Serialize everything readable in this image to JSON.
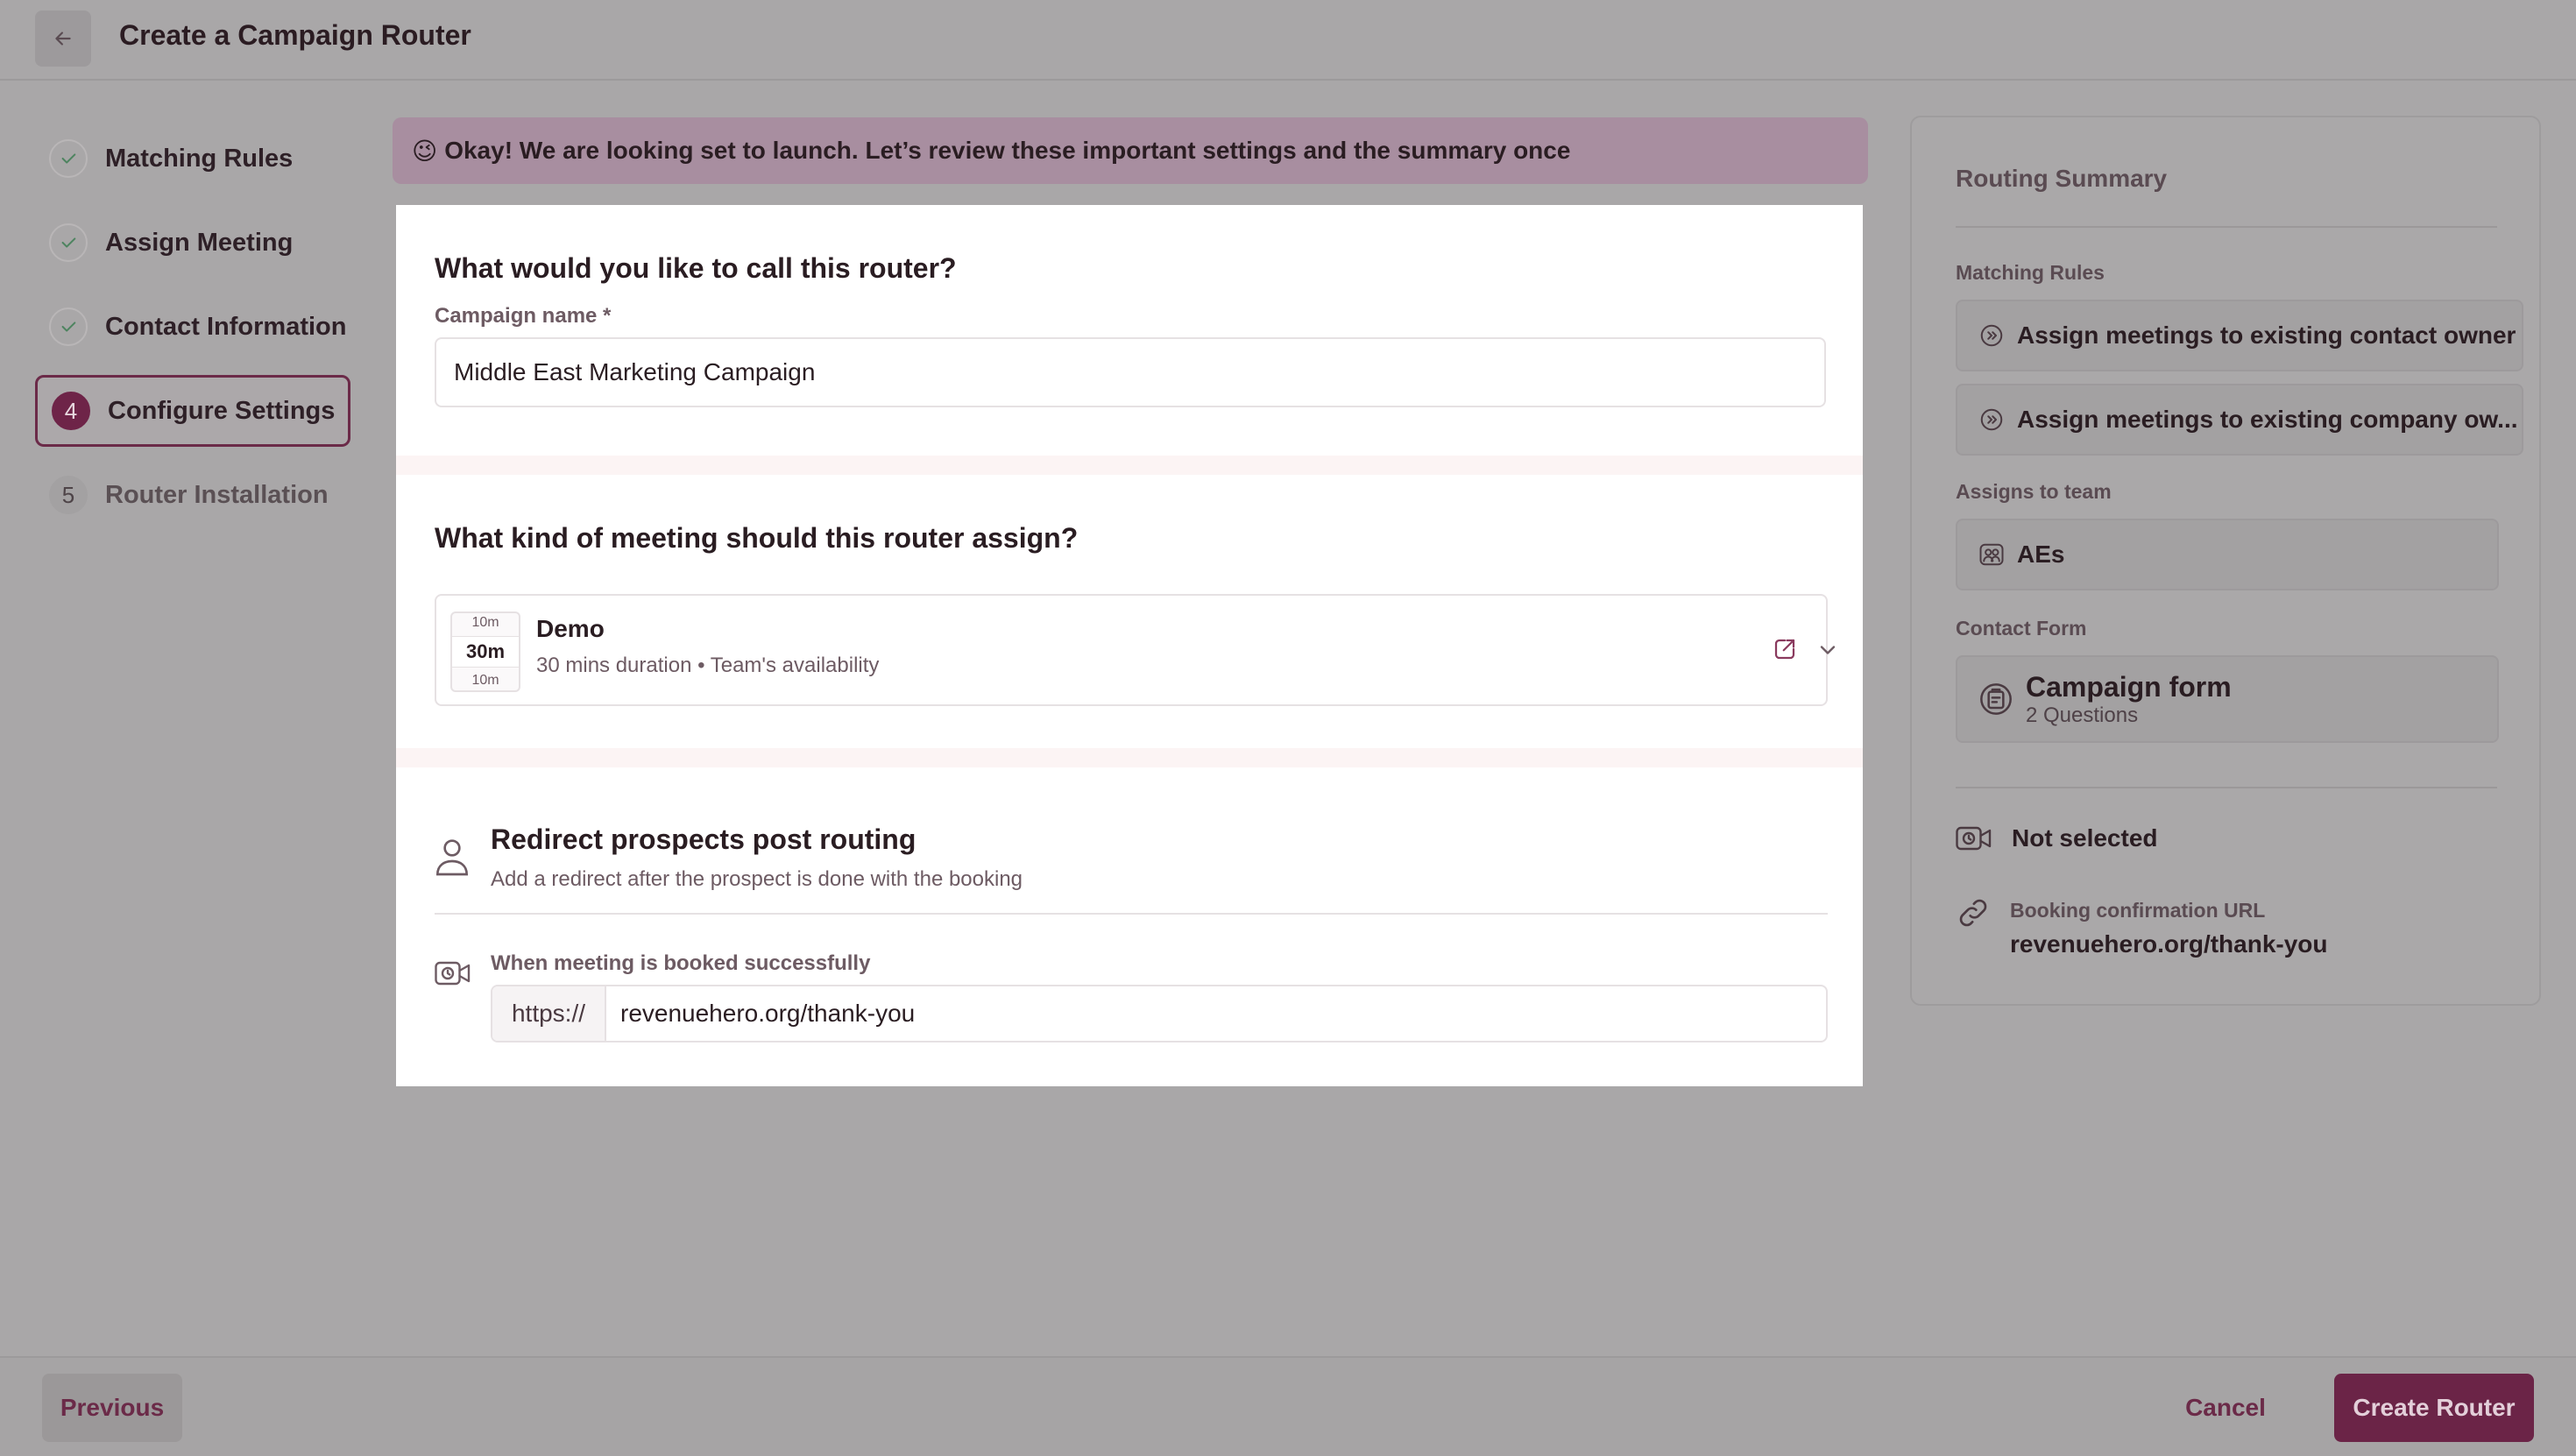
{
  "header": {
    "title": "Create a Campaign Router"
  },
  "steps": [
    {
      "label": "Matching Rules",
      "state": "done"
    },
    {
      "label": "Assign Meeting",
      "state": "done"
    },
    {
      "label": "Contact Information",
      "state": "done"
    },
    {
      "number": "4",
      "label": "Configure Settings",
      "state": "active"
    },
    {
      "number": "5",
      "label": "Router Installation",
      "state": "pending"
    }
  ],
  "banner": {
    "emoji": "😉",
    "text": "Okay! We are looking set to launch. Let’s review these important settings and the summary once"
  },
  "name_section": {
    "heading": "What would you like to call this router?",
    "field_label": "Campaign name *",
    "field_value": "Middle East Marketing Campaign"
  },
  "meeting_section": {
    "heading": "What kind of meeting should this router assign?",
    "duration_top": "10m",
    "duration_main": "30m",
    "duration_bottom": "10m",
    "meeting_name": "Demo",
    "meeting_details": "30 mins duration  •  Team's availability"
  },
  "redirect_section": {
    "title": "Redirect prospects post routing",
    "subtitle": "Add a redirect after the prospect is done with the booking",
    "booked_label": "When meeting is booked successfully",
    "url_prefix": "https://",
    "url_value": "revenuehero.org/thank-you"
  },
  "summary": {
    "title": "Routing Summary",
    "matching_rules_label": "Matching Rules",
    "rules": [
      "Assign meetings to existing contact owner",
      "Assign meetings to existing company ow..."
    ],
    "team_label": "Assigns to team",
    "team": "AEs",
    "contact_form_label": "Contact Form",
    "form_name": "Campaign form",
    "form_questions": "2 Questions",
    "not_selected": "Not selected",
    "booking_url_label": "Booking confirmation URL",
    "booking_url": "revenuehero.org/thank-you"
  },
  "footer": {
    "previous": "Previous",
    "cancel": "Cancel",
    "create": "Create Router"
  },
  "colors": {
    "accent": "#6b2447",
    "banner": "#a88ea0",
    "check": "#5a8a66"
  }
}
